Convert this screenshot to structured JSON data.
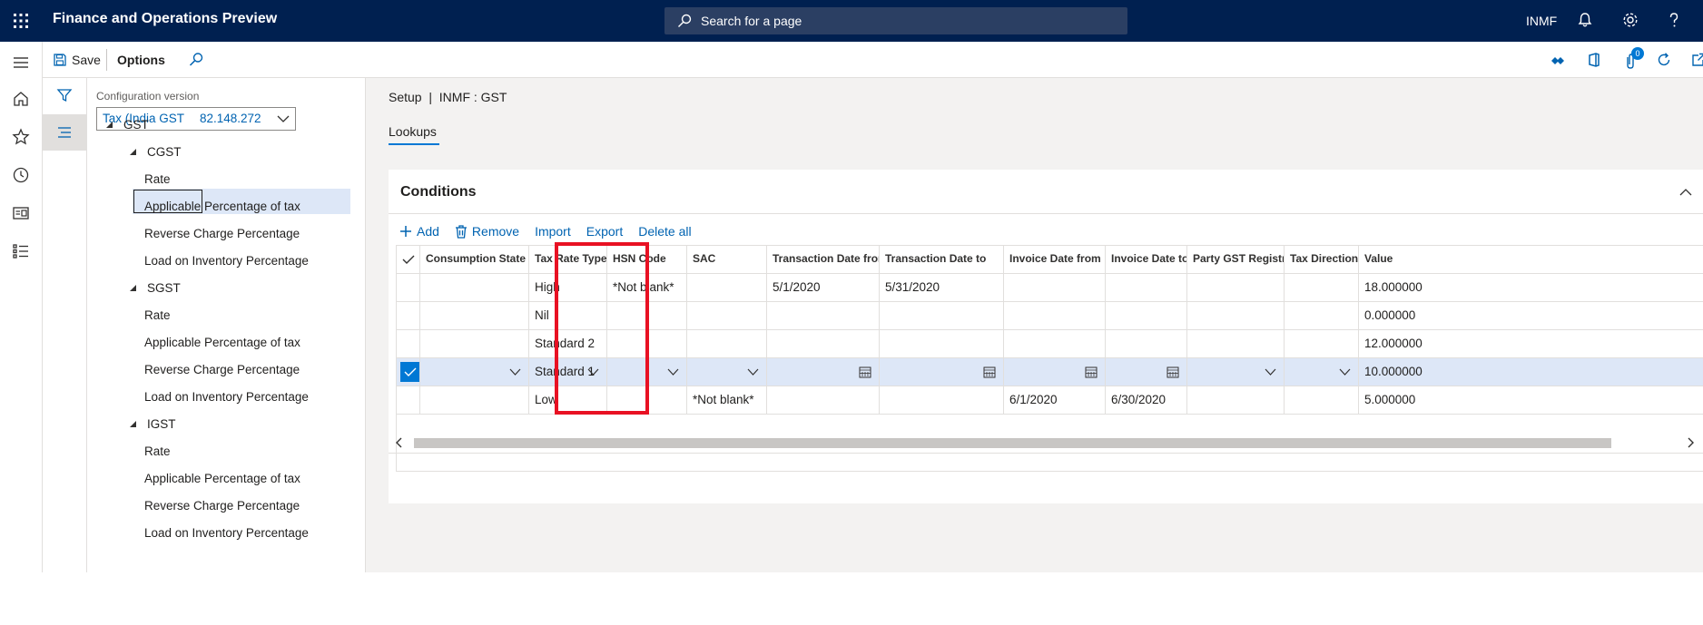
{
  "app": {
    "title": "Finance and Operations Preview",
    "company": "INMF"
  },
  "search": {
    "placeholder": "Search for a page"
  },
  "actionpane": {
    "save_label": "Save",
    "options_label": "Options",
    "badge_count": "0"
  },
  "filter_pane": {
    "config_label": "Configuration version",
    "config_name": "Tax (India GST",
    "config_version": "82.148.272"
  },
  "tree": [
    {
      "label": "GST",
      "level": 0,
      "expanded": true
    },
    {
      "label": "CGST",
      "level": 1,
      "expanded": true
    },
    {
      "label": "Rate",
      "level": 2,
      "selected": true
    },
    {
      "label": "Applicable Percentage of tax",
      "level": 2
    },
    {
      "label": "Reverse Charge Percentage",
      "level": 2
    },
    {
      "label": "Load on Inventory Percentage",
      "level": 2
    },
    {
      "label": "SGST",
      "level": 1,
      "expanded": true
    },
    {
      "label": "Rate",
      "level": 2
    },
    {
      "label": "Applicable Percentage of tax",
      "level": 2
    },
    {
      "label": "Reverse Charge Percentage",
      "level": 2
    },
    {
      "label": "Load on Inventory Percentage",
      "level": 2
    },
    {
      "label": "IGST",
      "level": 1,
      "expanded": true
    },
    {
      "label": "Rate",
      "level": 2
    },
    {
      "label": "Applicable Percentage of tax",
      "level": 2
    },
    {
      "label": "Reverse Charge Percentage",
      "level": 2
    },
    {
      "label": "Load on Inventory Percentage",
      "level": 2
    }
  ],
  "breadcrumb": {
    "text": "Setup  |  INMF : GST"
  },
  "tabs": {
    "lookups": "Lookups"
  },
  "conditions": {
    "title": "Conditions",
    "toolbar": {
      "add": "Add",
      "remove": "Remove",
      "import": "Import",
      "export": "Export",
      "delete_all": "Delete all"
    },
    "columns": [
      "Consumption State",
      "Tax Rate Type",
      "HSN Code",
      "SAC",
      "Transaction Date from",
      "Transaction Date to",
      "Invoice Date from",
      "Invoice Date to",
      "Party GST Registrat...",
      "Tax Direction",
      "Value"
    ],
    "rows": [
      [
        "",
        "High",
        "*Not blank*",
        "",
        "5/1/2020",
        "5/31/2020",
        "",
        "",
        "",
        "",
        "18.000000"
      ],
      [
        "",
        "Nil",
        "",
        "",
        "",
        "",
        "",
        "",
        "",
        "",
        "0.000000"
      ],
      [
        "",
        "Standard 2",
        "",
        "",
        "",
        "",
        "",
        "",
        "",
        "",
        "12.000000"
      ],
      [
        "",
        "Standard 1",
        "",
        "",
        "",
        "",
        "",
        "",
        "",
        "",
        "10.000000"
      ],
      [
        "",
        "Low",
        "",
        "*Not blank*",
        "",
        "",
        "6/1/2020",
        "6/30/2020",
        "",
        "",
        "5.000000"
      ]
    ],
    "selected_row": 3
  },
  "colors": {
    "nav": "#002050",
    "accent": "#0078d4",
    "link": "#0063b1",
    "highlight": "#e81123",
    "selection": "#dde7f7"
  }
}
